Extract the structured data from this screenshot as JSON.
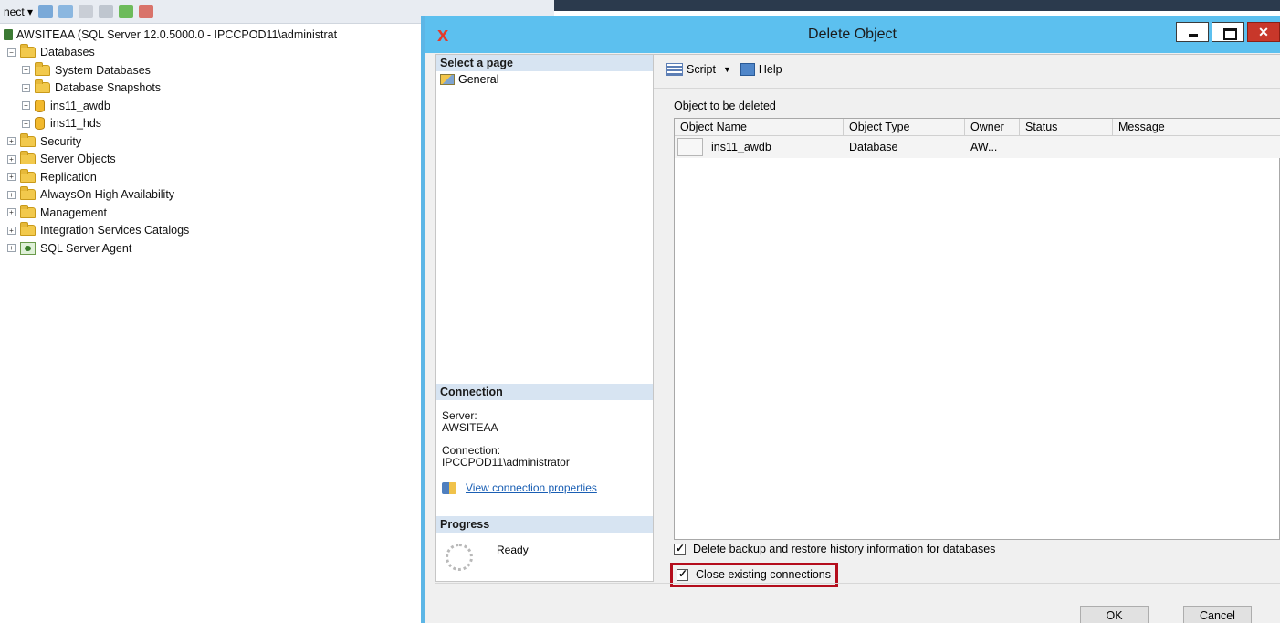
{
  "explorer": {
    "toolbar_label": "nect",
    "server_node": "AWSITEAA (SQL Server 12.0.5000.0 - IPCCPOD11\\administrat",
    "nodes": [
      {
        "label": "Databases",
        "level": 1,
        "expander": "−",
        "icon": "folder-icon"
      },
      {
        "label": "System Databases",
        "level": 2,
        "expander": "+",
        "icon": "folder-icon"
      },
      {
        "label": "Database Snapshots",
        "level": 2,
        "expander": "+",
        "icon": "folder-icon"
      },
      {
        "label": "ins11_awdb",
        "level": 2,
        "expander": "+",
        "icon": "database-icon"
      },
      {
        "label": "ins11_hds",
        "level": 2,
        "expander": "+",
        "icon": "database-icon"
      },
      {
        "label": "Security",
        "level": 1,
        "expander": "+",
        "icon": "folder-icon"
      },
      {
        "label": "Server Objects",
        "level": 1,
        "expander": "+",
        "icon": "folder-icon"
      },
      {
        "label": "Replication",
        "level": 1,
        "expander": "+",
        "icon": "folder-icon"
      },
      {
        "label": "AlwaysOn High Availability",
        "level": 1,
        "expander": "+",
        "icon": "folder-icon"
      },
      {
        "label": "Management",
        "level": 1,
        "expander": "+",
        "icon": "folder-icon"
      },
      {
        "label": "Integration Services Catalogs",
        "level": 1,
        "expander": "+",
        "icon": "folder-icon"
      },
      {
        "label": "SQL Server Agent",
        "level": 1,
        "expander": "+",
        "icon": "sql-agent-icon"
      }
    ]
  },
  "dialog": {
    "title": "Delete Object",
    "close_glyph": "x",
    "left_pane": {
      "select_page_header": "Select a page",
      "pages": [
        "General"
      ],
      "connection_header": "Connection",
      "server_label": "Server:",
      "server_value": "AWSITEAA",
      "connection_label": "Connection:",
      "connection_value": "IPCCPOD11\\administrator",
      "view_connection_link": "View connection properties",
      "progress_header": "Progress",
      "progress_status": "Ready"
    },
    "toolbar": {
      "script_label": "Script",
      "help_label": "Help"
    },
    "object_caption": "Object to be deleted",
    "grid": {
      "columns": [
        "Object Name",
        "Object Type",
        "Owner",
        "Status",
        "Message"
      ],
      "rows": [
        {
          "name": "ins11_awdb",
          "type": "Database",
          "owner": "AW...",
          "status": "",
          "message": ""
        }
      ]
    },
    "options": {
      "delete_history_label": "Delete backup and restore history information for databases",
      "delete_history_checked": true,
      "close_connections_label": "Close existing connections",
      "close_connections_checked": true
    },
    "buttons": {
      "ok": "OK",
      "cancel": "Cancel"
    }
  },
  "colors": {
    "title_bar": "#5cc0ef",
    "highlight_box": "#b40d1c",
    "pane_header": "#d7e4f2",
    "link": "#1a5fb4"
  }
}
